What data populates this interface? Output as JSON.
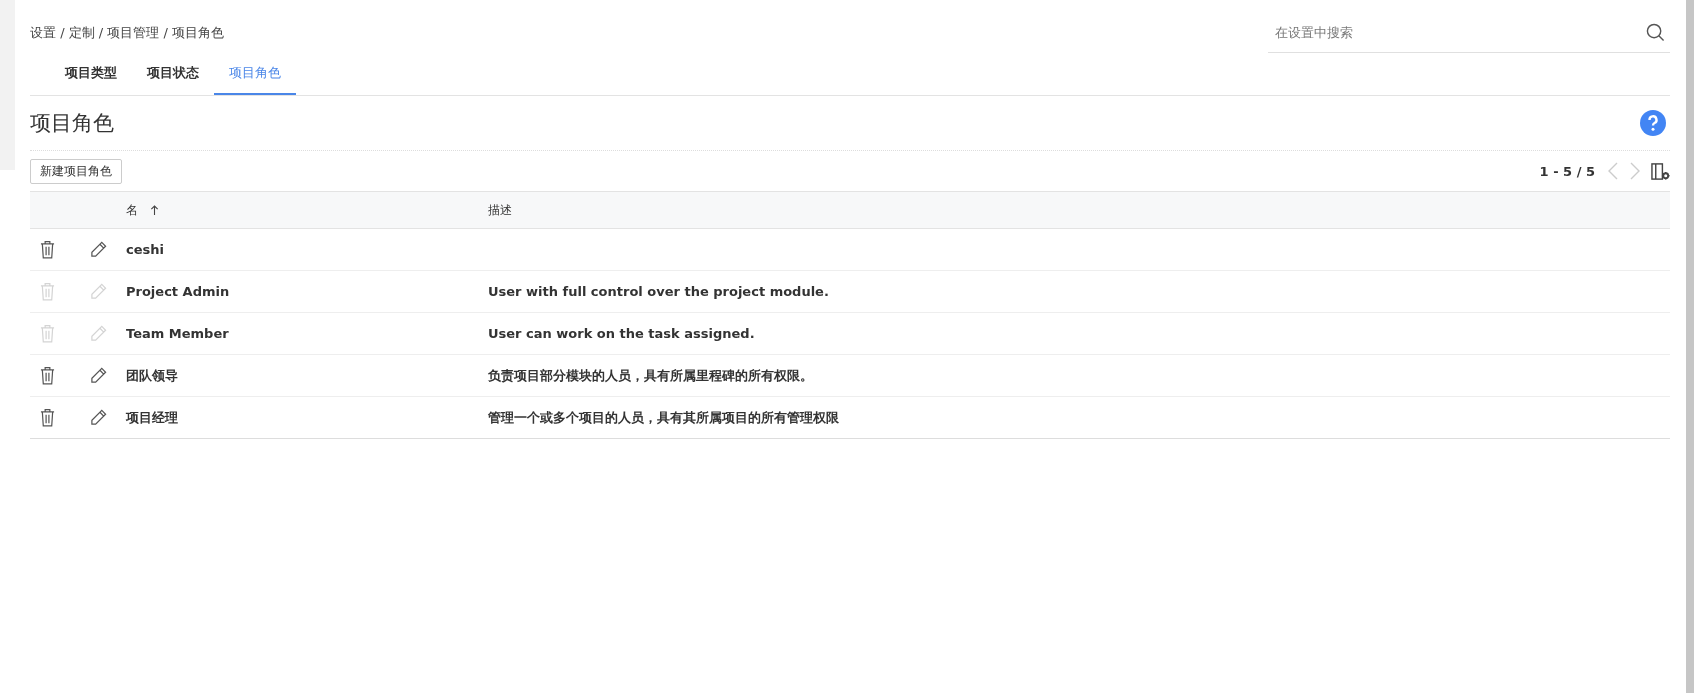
{
  "breadcrumb": "设置 / 定制 / 项目管理 / 项目角色",
  "search": {
    "placeholder": "在设置中搜索"
  },
  "tabs": [
    {
      "label": "项目类型",
      "selected": false
    },
    {
      "label": "项目状态",
      "selected": false
    },
    {
      "label": "项目角色",
      "selected": true
    }
  ],
  "page_title": "项目角色",
  "new_button": "新建项目角色",
  "pagination": "1 - 5 / 5",
  "table": {
    "columns": [
      "名",
      "描述"
    ],
    "rows": [
      {
        "name": "ceshi",
        "description": "",
        "disabled": false
      },
      {
        "name": "Project Admin",
        "description": "User with full control over the project module.",
        "disabled": true
      },
      {
        "name": "Team Member",
        "description": "User can work on the task assigned.",
        "disabled": true
      },
      {
        "name": "团队领导",
        "description": "负责项目部分模块的人员，具有所属里程碑的所有权限。",
        "disabled": false
      },
      {
        "name": "项目经理",
        "description": "管理一个或多个项目的人员，具有其所属项目的所有管理权限",
        "disabled": false
      }
    ]
  }
}
